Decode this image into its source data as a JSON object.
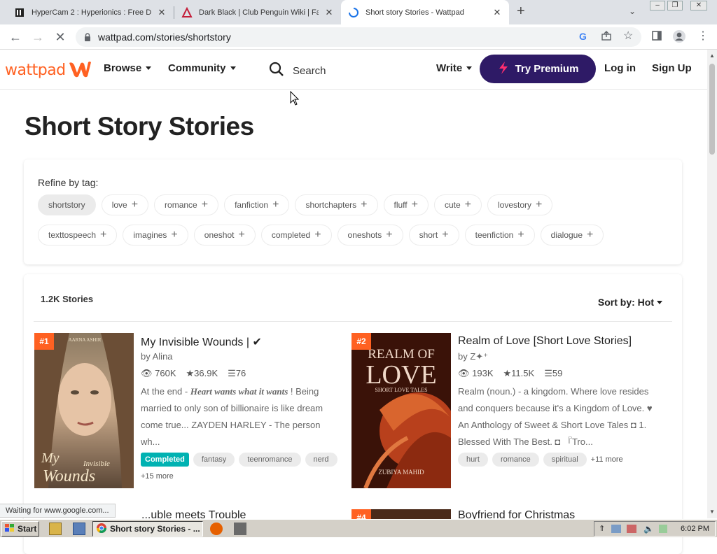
{
  "browser": {
    "tabs": [
      {
        "title": "HyperCam 2 : Hyperionics : Free Do",
        "favicon": "hypercam-icon"
      },
      {
        "title": "Dark Black | Club Penguin Wiki | Fa",
        "favicon": "wiki-icon"
      },
      {
        "title": "Short story Stories - Wattpad",
        "favicon": "loading-spinner-icon",
        "active": true
      }
    ],
    "new_tab": "+",
    "url": "wattpad.com/stories/shortstory"
  },
  "header": {
    "logo": "wattpad",
    "browse": "Browse",
    "community": "Community",
    "search": "Search",
    "write": "Write",
    "premium": "Try Premium",
    "login": "Log in",
    "signup": "Sign Up"
  },
  "page": {
    "title": "Short Story Stories",
    "refine_label": "Refine by tag:",
    "tags_row1": [
      "shortstory",
      "love",
      "romance",
      "fanfiction",
      "shortchapters",
      "fluff",
      "cute",
      "lovestory"
    ],
    "tags_row2": [
      "texttospeech",
      "imagines",
      "oneshot",
      "completed",
      "oneshots",
      "short",
      "teenfiction",
      "dialogue"
    ],
    "story_count": "1.2K Stories",
    "sort_label": "Sort by: Hot"
  },
  "stories": [
    {
      "rank": "#1",
      "title": "My Invisible Wounds | ✔",
      "author": "by Alina",
      "reads": "760K",
      "votes": "36.9K",
      "parts": "76",
      "desc_pre": "At the end - ",
      "desc_em": "Heart wants what it wants",
      "desc_post": " ! Being married to only son of billionaire is like dream come true... ZAYDEN HARLEY - The person wh...",
      "status": "Completed",
      "tags": [
        "fantasy",
        "teenromance",
        "nerd"
      ],
      "more": "+15 more",
      "cover_text": "My Invisible Wounds",
      "cover_author": "AARNA ASHIR"
    },
    {
      "rank": "#2",
      "title": "Realm of Love [Short Love Stories]",
      "author": "by Z✦⁺",
      "reads": "193K",
      "votes": "11.5K",
      "parts": "59",
      "desc": "Realm (noun.) - a kingdom. Where love resides and conquers because it's a Kingdom of Love. ♥ An Anthology of Sweet & Short Love Tales ◘ 1. Blessed With The Best. ◘ 『Tro...",
      "tags": [
        "hurt",
        "romance",
        "spiritual"
      ],
      "more": "+11 more",
      "cover_title1": "REALM OF",
      "cover_title2": "LOVE",
      "cover_sub": "SHORT LOVE TALES",
      "cover_author": "ZUBIYA MAHID"
    }
  ],
  "partial_titles": [
    "...uble meets Trouble",
    "Boyfriend for Christmas"
  ],
  "partial_ranks": [
    "#4"
  ],
  "status_bar": "Waiting for www.google.com...",
  "taskbar": {
    "start": "Start",
    "active_task": "Short story Stories - ...",
    "clock": "6:02 PM"
  },
  "colors": {
    "brand": "#ff6122",
    "premium": "#2e1a66",
    "completed": "#00b2b2"
  }
}
